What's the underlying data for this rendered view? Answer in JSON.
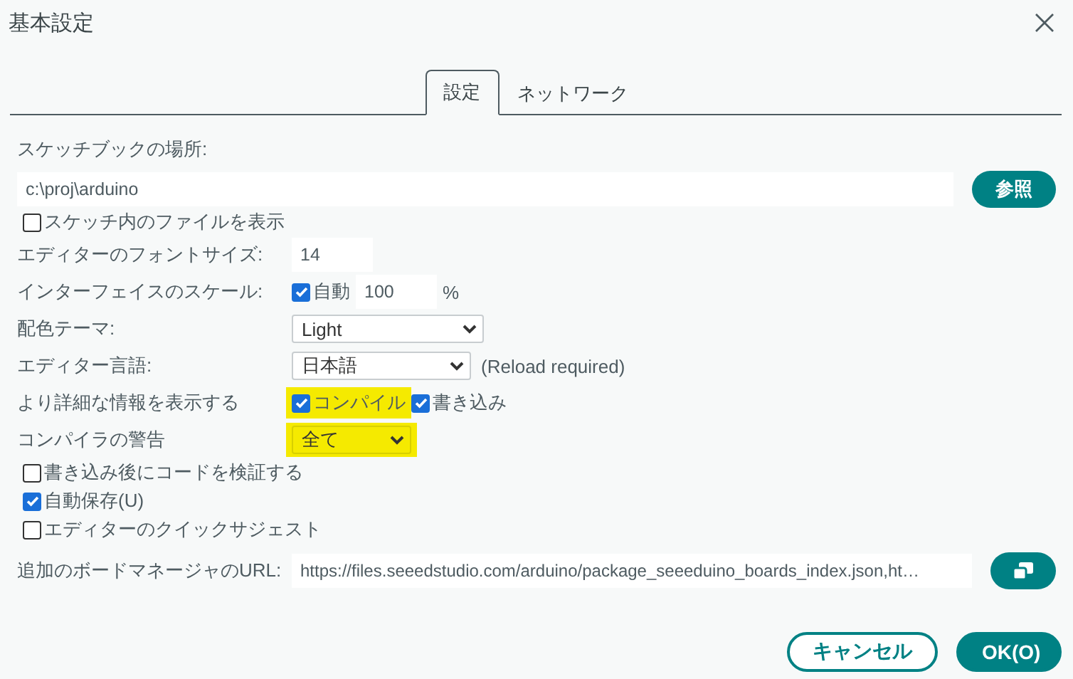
{
  "window": {
    "title": "基本設定"
  },
  "tabs": [
    {
      "label": "設定",
      "selected": true
    },
    {
      "label": "ネットワーク",
      "selected": false
    }
  ],
  "sketchbook": {
    "label": "スケッチブックの場所:",
    "value": "c:\\proj\\arduino",
    "button": "参照"
  },
  "settings": [
    {
      "kind": "checkbox",
      "label": "スケッチ内のファイルを表示",
      "checked": false
    },
    {
      "kind": "input",
      "label": "エディターのフォントサイズ:",
      "value": "14"
    },
    {
      "kind": "scale",
      "label": "インターフェイスのスケール:",
      "auto_label": "自動",
      "checked": true,
      "value": "100",
      "unit": "%"
    },
    {
      "kind": "select",
      "label": "配色テーマ:",
      "value": "Light",
      "highlighted": false
    },
    {
      "kind": "select",
      "label": "エディター言語:",
      "value": "日本語",
      "note": "(Reload required)",
      "highlighted": false
    },
    {
      "kind": "checks",
      "label": "より詳細な情報を表示する",
      "options": [
        {
          "label": "コンパイル",
          "checked": true,
          "highlighted": true
        },
        {
          "label": "書き込み",
          "checked": true,
          "highlighted": false
        }
      ]
    },
    {
      "kind": "select",
      "label": "コンパイラの警告",
      "value": "全て",
      "highlighted": true
    },
    {
      "kind": "checkbox",
      "label": "書き込み後にコードを検証する",
      "checked": false
    },
    {
      "kind": "checkbox",
      "label": "自動保存(U)",
      "checked": true
    },
    {
      "kind": "checkbox",
      "label": "エディターのクイックサジェスト",
      "checked": false
    }
  ],
  "url": {
    "label": "追加のボードマネージャのURL:",
    "value": "https://files.seeedstudio.com/arduino/package_seeeduino_boards_index.json,ht…"
  },
  "buttons": [
    {
      "label": "キャンセル",
      "kind": "secondary"
    },
    {
      "label": "OK(O)",
      "kind": "primary"
    }
  ]
}
